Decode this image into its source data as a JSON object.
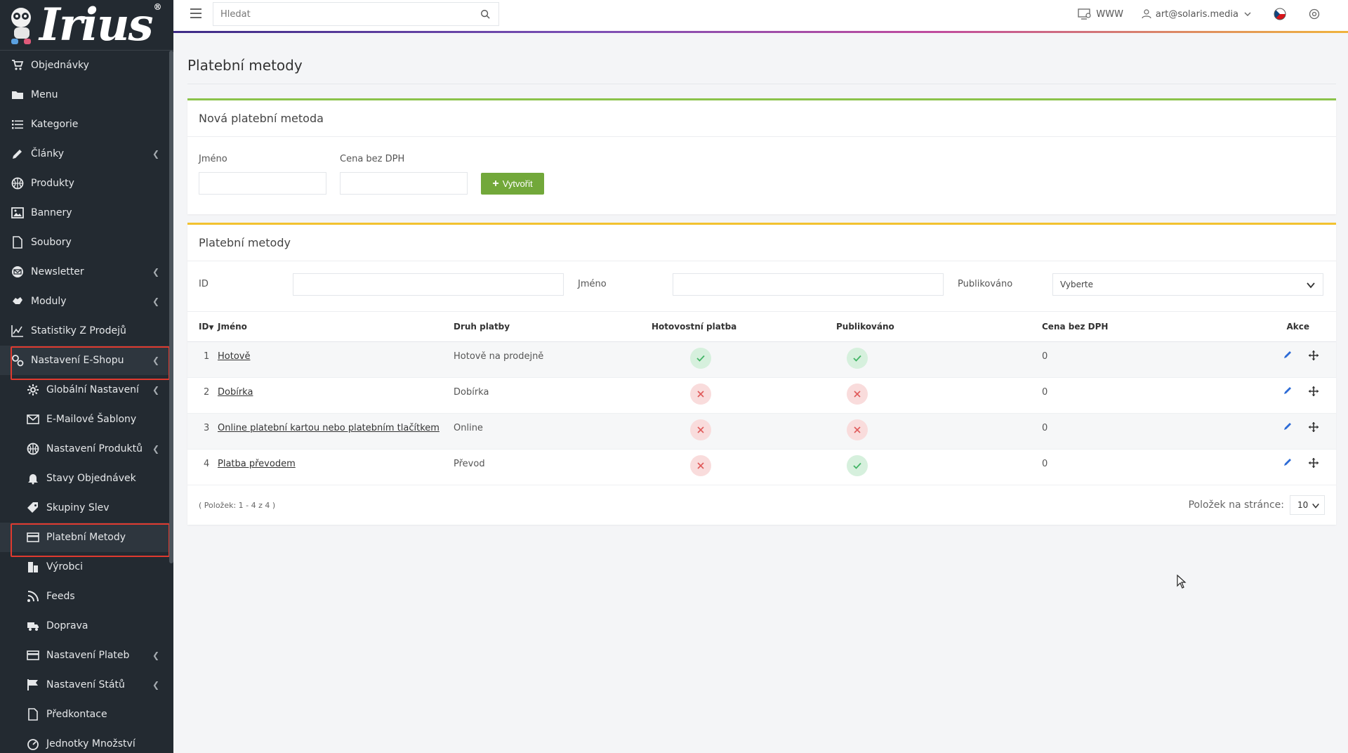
{
  "brand": {
    "logo_text": "Irius",
    "reg_mark": "®"
  },
  "sidebar": {
    "items": [
      {
        "label": "Objednávky",
        "icon": "cart-icon",
        "chev": false,
        "sub": false,
        "hl": false
      },
      {
        "label": "Menu",
        "icon": "folder-icon",
        "chev": false,
        "sub": false,
        "hl": false
      },
      {
        "label": "Kategorie",
        "icon": "list-icon",
        "chev": false,
        "sub": false,
        "hl": false
      },
      {
        "label": "Články",
        "icon": "pencil-icon",
        "chev": true,
        "sub": false,
        "hl": false
      },
      {
        "label": "Produkty",
        "icon": "basketball-icon",
        "chev": false,
        "sub": false,
        "hl": false
      },
      {
        "label": "Bannery",
        "icon": "image-icon",
        "chev": false,
        "sub": false,
        "hl": false
      },
      {
        "label": "Soubory",
        "icon": "file-icon",
        "chev": false,
        "sub": false,
        "hl": false
      },
      {
        "label": "Newsletter",
        "icon": "envelope-circle-icon",
        "chev": true,
        "sub": false,
        "hl": false
      },
      {
        "label": "Moduly",
        "icon": "hand-icon",
        "chev": true,
        "sub": false,
        "hl": false
      },
      {
        "label": "Statistiky Z Prodejů",
        "icon": "chart-icon",
        "chev": false,
        "sub": false,
        "hl": false
      },
      {
        "label": "Nastavení E-Shopu",
        "icon": "shop-settings-icon",
        "chev": true,
        "sub": false,
        "hl": true
      },
      {
        "label": "Globální Nastavení",
        "icon": "gear-icon",
        "chev": true,
        "sub": true,
        "hl": false
      },
      {
        "label": "E-Mailové Šablony",
        "icon": "mail-icon",
        "chev": false,
        "sub": true,
        "hl": false
      },
      {
        "label": "Nastavení Produktů",
        "icon": "basketball-icon",
        "chev": true,
        "sub": true,
        "hl": false
      },
      {
        "label": "Stavy Objednávek",
        "icon": "bell-icon",
        "chev": false,
        "sub": true,
        "hl": false
      },
      {
        "label": "Skupiny Slev",
        "icon": "tag-icon",
        "chev": false,
        "sub": true,
        "hl": false
      },
      {
        "label": "Platební Metody",
        "icon": "credit-card-icon",
        "chev": false,
        "sub": true,
        "hl": true
      },
      {
        "label": "Výrobci",
        "icon": "building-icon",
        "chev": false,
        "sub": true,
        "hl": false
      },
      {
        "label": "Feeds",
        "icon": "feed-icon",
        "chev": false,
        "sub": true,
        "hl": false
      },
      {
        "label": "Doprava",
        "icon": "truck-icon",
        "chev": false,
        "sub": true,
        "hl": false
      },
      {
        "label": "Nastavení Plateb",
        "icon": "credit-card-icon",
        "chev": true,
        "sub": true,
        "hl": false
      },
      {
        "label": "Nastavení Států",
        "icon": "flag-icon",
        "chev": true,
        "sub": true,
        "hl": false
      },
      {
        "label": "Předkontace",
        "icon": "file-icon",
        "chev": false,
        "sub": true,
        "hl": false
      },
      {
        "label": "Jednotky Množství",
        "icon": "gauge-icon",
        "chev": false,
        "sub": true,
        "hl": false
      }
    ]
  },
  "topbar": {
    "search_placeholder": "Hledat",
    "www_label": "WWW",
    "user_email": "art@solaris.media"
  },
  "page": {
    "title": "Platební metody"
  },
  "new_method": {
    "header": "Nová platební metoda",
    "name_label": "Jméno",
    "price_label": "Cena bez DPH",
    "create_label": "Vytvořit"
  },
  "methods": {
    "header": "Platební metody",
    "filters": {
      "id_label": "ID",
      "name_label": "Jméno",
      "published_label": "Publikováno",
      "published_select": "Vyberte"
    },
    "columns": {
      "id": "ID",
      "name": "Jméno",
      "type": "Druh platby",
      "cash": "Hotovostní platba",
      "published": "Publikováno",
      "price": "Cena bez DPH",
      "actions": "Akce"
    },
    "rows": [
      {
        "id": "1",
        "name": "Hotově",
        "type": "Hotově na prodejně",
        "cash": true,
        "published": true,
        "price": "0"
      },
      {
        "id": "2",
        "name": "Dobírka",
        "type": "Dobírka",
        "cash": false,
        "published": false,
        "price": "0"
      },
      {
        "id": "3",
        "name": "Online platební kartou nebo platebním tlačítkem",
        "type": "Online",
        "cash": false,
        "published": false,
        "price": "0"
      },
      {
        "id": "4",
        "name": "Platba převodem",
        "type": "Převod",
        "cash": false,
        "published": true,
        "price": "0"
      }
    ],
    "pagination_info": "( Položek: 1 - 4 z 4 )",
    "per_page_label": "Položek na stránce:",
    "per_page_value": "10"
  },
  "colors": {
    "sidebar_bg": "#232a31",
    "highlight_border": "#e03a2f",
    "accent_green": "#72a83a",
    "card_green": "#8bc34a",
    "card_yellow": "#f2c230",
    "link_blue": "#2c6bd6"
  }
}
